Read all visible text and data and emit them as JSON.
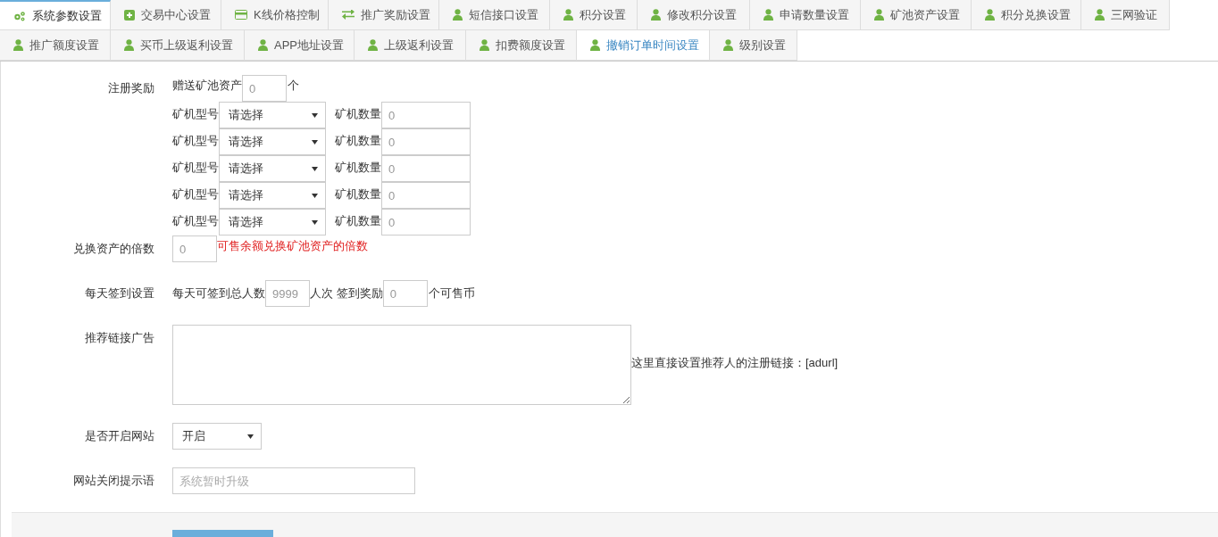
{
  "tab_rows": [
    {
      "tabs": [
        {
          "label": "系统参数设置",
          "kind": "gears",
          "selected": true,
          "highlighted": false
        },
        {
          "label": "交易中心设置",
          "kind": "plus",
          "selected": false,
          "highlighted": false
        },
        {
          "label": "K线价格控制",
          "kind": "card",
          "selected": false,
          "highlighted": false
        },
        {
          "label": "推广奖励设置",
          "kind": "exchange",
          "selected": false,
          "highlighted": false
        },
        {
          "label": "短信接口设置",
          "kind": "user",
          "selected": false,
          "highlighted": false
        },
        {
          "label": "积分设置",
          "kind": "user",
          "selected": false,
          "highlighted": false
        },
        {
          "label": "修改积分设置",
          "kind": "user",
          "selected": false,
          "highlighted": false
        },
        {
          "label": "申请数量设置",
          "kind": "user",
          "selected": false,
          "highlighted": false
        },
        {
          "label": "矿池资产设置",
          "kind": "user",
          "selected": false,
          "highlighted": false
        },
        {
          "label": "积分兑换设置",
          "kind": "user",
          "selected": false,
          "highlighted": false
        },
        {
          "label": "三网验证",
          "kind": "user",
          "selected": false,
          "highlighted": false
        }
      ]
    },
    {
      "tabs": [
        {
          "label": "推广额度设置",
          "kind": "user",
          "selected": false,
          "highlighted": false
        },
        {
          "label": "买币上级返利设置",
          "kind": "user",
          "selected": false,
          "highlighted": false
        },
        {
          "label": "APP地址设置",
          "kind": "user",
          "selected": false,
          "highlighted": false
        },
        {
          "label": "上级返利设置",
          "kind": "user",
          "selected": false,
          "highlighted": false
        },
        {
          "label": "扣费额度设置",
          "kind": "user",
          "selected": false,
          "highlighted": false
        },
        {
          "label": "撤销订单时间设置",
          "kind": "user",
          "selected": false,
          "highlighted": true
        },
        {
          "label": "级别设置",
          "kind": "user",
          "selected": false,
          "highlighted": false
        }
      ]
    }
  ],
  "register_reward": {
    "label": "注册奖励",
    "gift_label": "赠送矿池资产",
    "gift_value": "0",
    "gift_unit": "个",
    "machines": [
      {
        "model_label": "矿机型号",
        "model_value": "请选择",
        "count_label": "矿机数量",
        "count_value": "0"
      },
      {
        "model_label": "矿机型号",
        "model_value": "请选择",
        "count_label": "矿机数量",
        "count_value": "0"
      },
      {
        "model_label": "矿机型号",
        "model_value": "请选择",
        "count_label": "矿机数量",
        "count_value": "0"
      },
      {
        "model_label": "矿机型号",
        "model_value": "请选择",
        "count_label": "矿机数量",
        "count_value": "0"
      },
      {
        "model_label": "矿机型号",
        "model_value": "请选择",
        "count_label": "矿机数量",
        "count_value": "0"
      }
    ]
  },
  "exchange": {
    "label": "兑换资产的倍数",
    "value": "0",
    "hint": "可售余额兑换矿池资产的倍数"
  },
  "checkin": {
    "label": "每天签到设置",
    "total_label": "每天可签到总人数",
    "total_value": "9999",
    "total_unit": "人次 签到奖励",
    "reward_value": "0",
    "reward_unit": "个可售币"
  },
  "ad": {
    "label": "推荐链接广告",
    "note": "这里直接设置推荐人的注册链接：[adurl]"
  },
  "site_open": {
    "label": "是否开启网站",
    "value": "开启"
  },
  "close_message": {
    "label": "网站关闭提示语",
    "placeholder": "系统暂时升级"
  }
}
